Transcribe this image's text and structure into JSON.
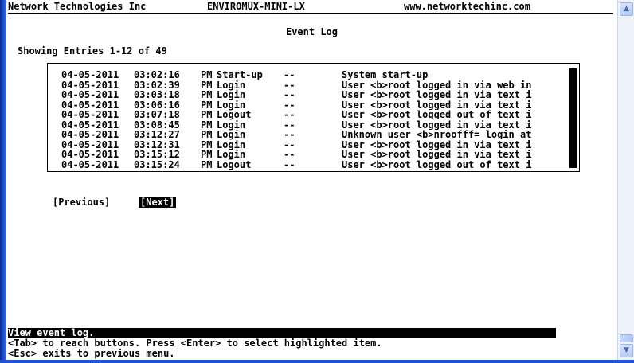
{
  "header": {
    "company": "Network Technologies Inc",
    "product": "ENVIROMUX-MINI-LX",
    "website": "www.networktechinc.com"
  },
  "page_title": "Event Log",
  "showing": "Showing Entries 1-12 of 49",
  "log_entries": [
    {
      "date": "04-05-2011",
      "time": "03:02:16",
      "ampm": "PM",
      "event": "Start-up",
      "dash": "--",
      "desc": "System start-up"
    },
    {
      "date": "04-05-2011",
      "time": "03:02:39",
      "ampm": "PM",
      "event": "Login",
      "dash": "--",
      "desc": "User <b>root logged in via web in"
    },
    {
      "date": "04-05-2011",
      "time": "03:03:18",
      "ampm": "PM",
      "event": "Login",
      "dash": "--",
      "desc": "User <b>root logged in via text i"
    },
    {
      "date": "04-05-2011",
      "time": "03:06:16",
      "ampm": "PM",
      "event": "Login",
      "dash": "--",
      "desc": "User <b>root logged in via text i"
    },
    {
      "date": "04-05-2011",
      "time": "03:07:18",
      "ampm": "PM",
      "event": "Logout",
      "dash": "--",
      "desc": "User <b>root logged out of text i"
    },
    {
      "date": "04-05-2011",
      "time": "03:08:45",
      "ampm": "PM",
      "event": "Login",
      "dash": "--",
      "desc": "User <b>root logged in via text i"
    },
    {
      "date": "04-05-2011",
      "time": "03:12:27",
      "ampm": "PM",
      "event": "Login",
      "dash": "--",
      "desc": "Unknown user <b>nroofff= login at"
    },
    {
      "date": "04-05-2011",
      "time": "03:12:31",
      "ampm": "PM",
      "event": "Login",
      "dash": "--",
      "desc": "User <b>root logged in via text i"
    },
    {
      "date": "04-05-2011",
      "time": "03:15:12",
      "ampm": "PM",
      "event": "Login",
      "dash": "--",
      "desc": "User <b>root logged in via text i"
    },
    {
      "date": "04-05-2011",
      "time": "03:15:24",
      "ampm": "PM",
      "event": "Logout",
      "dash": "--",
      "desc": "User <b>root logged out of text i"
    }
  ],
  "buttons": {
    "previous": "[Previous]",
    "next": "[Next]"
  },
  "status": "View event log.",
  "help": [
    "<Tab> to reach buttons. Press <Enter> to select highlighted item.",
    "<Esc> exits to previous menu."
  ],
  "scrollbar": {
    "up_icon": "scroll-up-arrow",
    "down_icon": "scroll-down-arrow"
  }
}
